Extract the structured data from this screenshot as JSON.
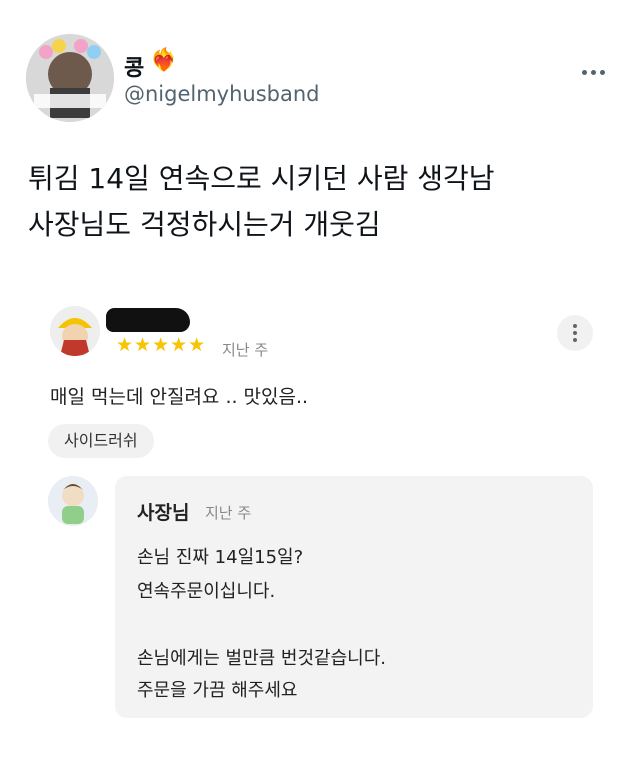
{
  "tweet": {
    "name": "콩",
    "heart": "❤️‍🔥",
    "handle": "@nigelmyhusband",
    "text_lines": [
      "튀김 14일 연속으로 시키던 사람 생각남",
      "사장님도 걱정하시는거 개웃김"
    ]
  },
  "review": {
    "stars": "★★★★★",
    "time": "지난 주",
    "body": "매일 먹는데 안질려요 .. 맛있음..",
    "chip": "사이드러쉬"
  },
  "reply": {
    "owner": "사장님",
    "time": "지난 주",
    "lines": [
      "손님 진짜 14일15일?",
      "연속주문이십니다.",
      "",
      "손님에게는 벌만큼 번것같습니다.",
      "주문을 가끔 해주세요"
    ]
  },
  "icons": {
    "more": "more-horizontal-icon",
    "kebab": "more-vertical-icon"
  }
}
